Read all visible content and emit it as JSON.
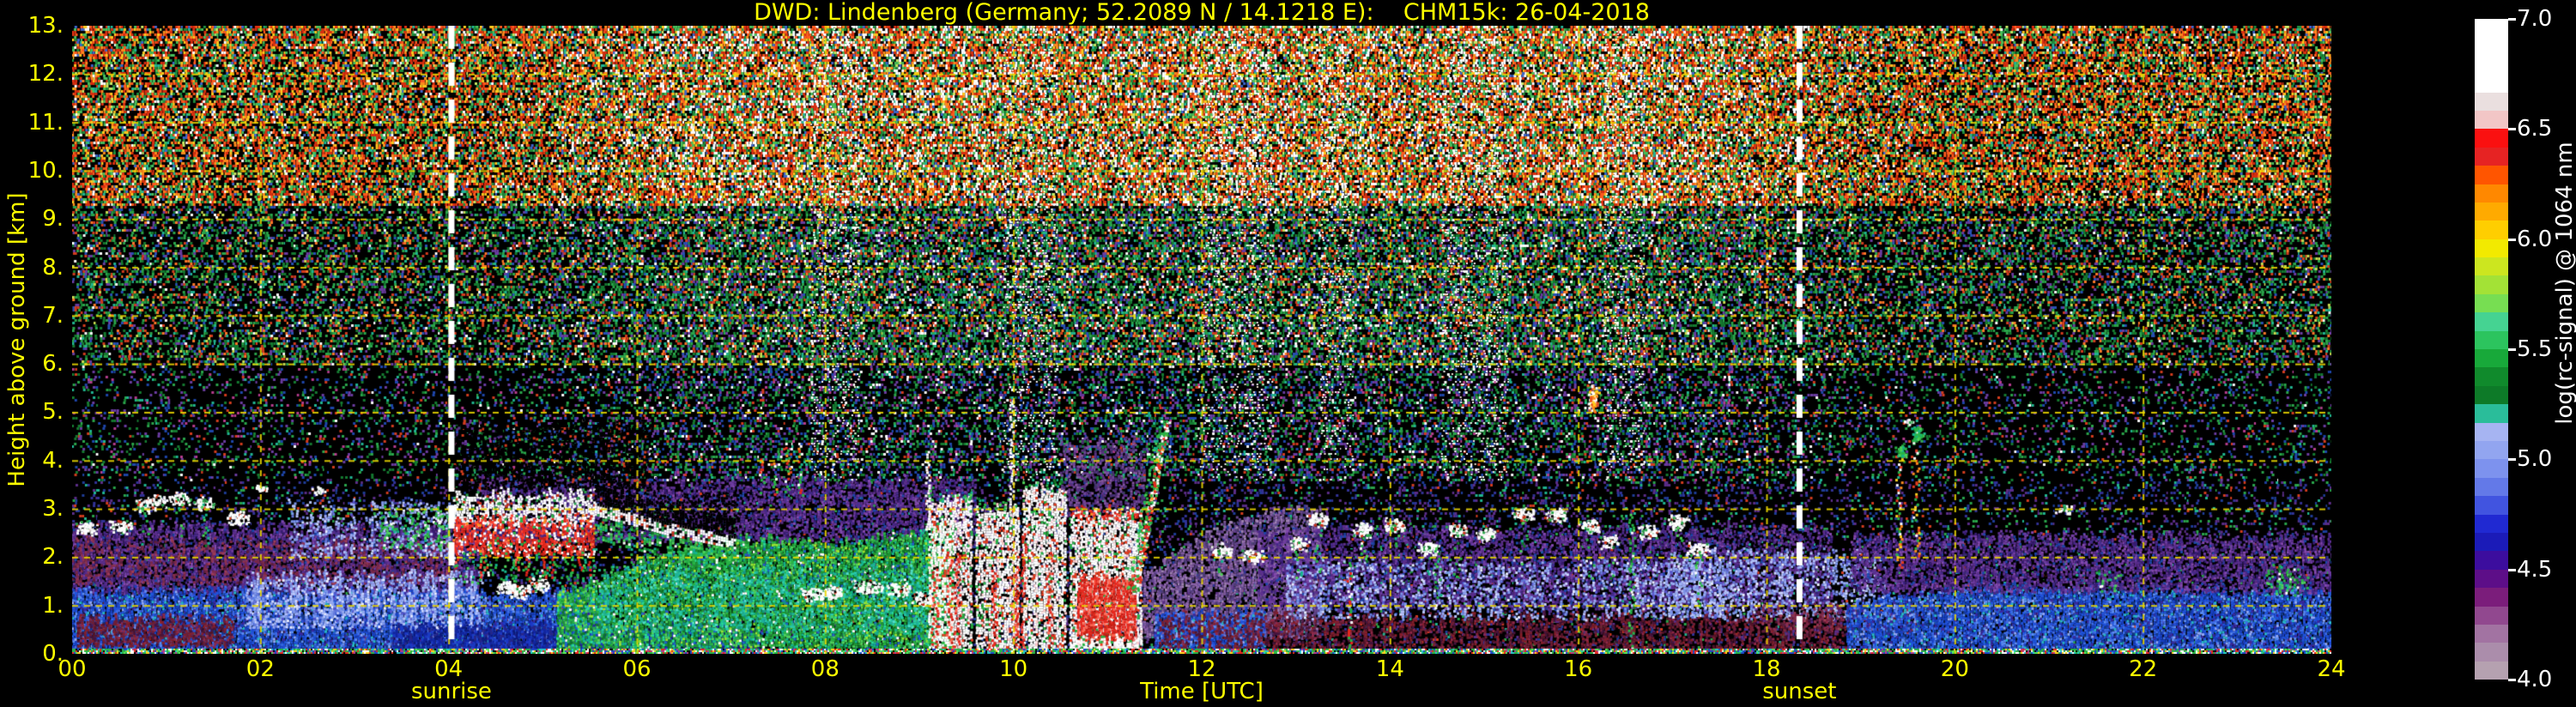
{
  "title": {
    "text": "DWD: Lindenberg (Germany; 52.2089 N / 14.1218 E):    CHM15k: 26-04-2018"
  },
  "axes": {
    "xlabel": "Time [UTC]",
    "ylabel": "Height above ground [km]",
    "x_ticks": [
      {
        "hour": 0,
        "label": "00"
      },
      {
        "hour": 2,
        "label": "02"
      },
      {
        "hour": 4,
        "label": "04"
      },
      {
        "hour": 6,
        "label": "06"
      },
      {
        "hour": 8,
        "label": "08"
      },
      {
        "hour": 10,
        "label": "10"
      },
      {
        "hour": 12,
        "label": "12"
      },
      {
        "hour": 14,
        "label": "14"
      },
      {
        "hour": 16,
        "label": "16"
      },
      {
        "hour": 18,
        "label": "18"
      },
      {
        "hour": 20,
        "label": "20"
      },
      {
        "hour": 22,
        "label": "22"
      },
      {
        "hour": 24,
        "label": "24"
      }
    ],
    "y_ticks": [
      {
        "km": 13,
        "label": "13."
      },
      {
        "km": 12,
        "label": "12."
      },
      {
        "km": 11,
        "label": "11."
      },
      {
        "km": 10,
        "label": "10."
      },
      {
        "km": 9,
        "label": "9."
      },
      {
        "km": 8,
        "label": "8."
      },
      {
        "km": 7,
        "label": "7."
      },
      {
        "km": 6,
        "label": "6."
      },
      {
        "km": 5,
        "label": "5."
      },
      {
        "km": 4,
        "label": "4."
      },
      {
        "km": 3,
        "label": "3."
      },
      {
        "km": 2,
        "label": "2."
      },
      {
        "km": 1,
        "label": "1."
      },
      {
        "km": 0,
        "label": "0."
      }
    ]
  },
  "annotations": {
    "sunrise": {
      "label": "sunrise",
      "hour": 4.03
    },
    "sunset": {
      "label": "sunset",
      "hour": 18.35
    }
  },
  "colorbar": {
    "label": "log(rc-signal) @ 1064 nm",
    "vmin": 4.0,
    "vmax": 7.0,
    "tick_labels": [
      "7.0",
      "6.5",
      "6.0",
      "5.5",
      "5.0",
      "4.5",
      "4.0"
    ],
    "colors": [
      "#ffffff",
      "#ffffff",
      "#ffffff",
      "#ffffff",
      "#eadfdf",
      "#f2c6c6",
      "#fa1010",
      "#e62323",
      "#ff5500",
      "#ff8800",
      "#ffaa00",
      "#ffce00",
      "#f2ea00",
      "#cce61f",
      "#a3e236",
      "#77de52",
      "#45d392",
      "#2cc45e",
      "#18a93a",
      "#108a2c",
      "#0d7a28",
      "#2abd9a",
      "#a6b4f2",
      "#92a5f0",
      "#7d92ee",
      "#6379e8",
      "#4154e0",
      "#2029d2",
      "#1b1bb8",
      "#3c0d9e",
      "#5d0e88",
      "#7b1d7b",
      "#91488f",
      "#a273a2",
      "#ab8dab",
      "#b5a1b0"
    ]
  },
  "style": {
    "text_color": "#ffff00",
    "colorbar_text_color": "#ffffff",
    "grid_color": "rgba(235,215,0,0.9)",
    "sun_line_color": "#ffffff",
    "background": "#000000"
  },
  "chart_data": {
    "type": "heatmap",
    "title": "DWD: Lindenberg (Germany; 52.2089 N / 14.1218 E):    CHM15k: 26-04-2018",
    "xlabel": "Time [UTC]",
    "ylabel": "Height above ground [km]",
    "zlabel": "log(rc-signal) @ 1064 nm",
    "x_range": [
      0,
      24
    ],
    "y_range": [
      0,
      13
    ],
    "z_range": [
      4.0,
      7.0
    ],
    "grid": {
      "x_step_hours": 2,
      "y_step_km": 1,
      "style": "yellow dashed"
    },
    "sun_lines_hours": [
      4.03,
      18.35
    ],
    "bright_columns": [
      [
        7.85,
        8.35
      ],
      [
        9.9,
        10.45
      ],
      [
        11.95,
        12.75
      ],
      [
        13.25,
        13.6
      ],
      [
        14.55,
        15.25
      ],
      [
        16.25,
        16.7
      ]
    ],
    "layers": [
      {
        "kind": "purple",
        "t0": 0,
        "t1": 4.3,
        "h0": 1.25,
        "h1": 2.65,
        "dens": 0.88
      },
      {
        "kind": "maroon",
        "t0": 0,
        "t1": 4.1,
        "h0": 1.45,
        "h1": 2.35,
        "dens": 0.6,
        "patch": true
      },
      {
        "kind": "blue",
        "t0": 0,
        "t1": 5.7,
        "h0": 0,
        "h1": 1.3,
        "dens": 0.97
      },
      {
        "kind": "maroon_low",
        "t0": 0.05,
        "t1": 1.7,
        "h0": 0.18,
        "h1": 0.72,
        "dens": 0.85
      },
      {
        "kind": "pale_blue",
        "t0": 1.85,
        "t1": 4.35,
        "h0": 0.55,
        "h1": 1.65,
        "dens": 0.8,
        "patch": true
      },
      {
        "kind": "pale_blue",
        "t0": 2.3,
        "t1": 4.1,
        "h0": 2.0,
        "h1": 3.1,
        "dens": 0.5,
        "patch": true
      },
      {
        "kind": "green_specks",
        "t0": 3.25,
        "t1": 4.05,
        "h0": 2.2,
        "h1": 3.0,
        "dens": 0.45,
        "patch": true
      },
      {
        "kind": "dark_blue",
        "t0": 3.4,
        "t1": 7.3,
        "h0": 0.08,
        "h1": 0.6,
        "dens": 0.95
      },
      {
        "kind": "purple",
        "t0": 4.3,
        "t1": 9.6,
        "h0": 2.35,
        "h1": 3.6,
        "dens": 0.75
      },
      {
        "kind": "green_layer",
        "t0": 5.15,
        "t1": 9.35,
        "h0": 0.12,
        "pts": [
          [
            5.15,
            1.25
          ],
          [
            6.1,
            2.0
          ],
          [
            7.0,
            2.4
          ],
          [
            8.3,
            2.3
          ],
          [
            9.35,
            2.7
          ]
        ],
        "dens": 0.97
      },
      {
        "kind": "teal",
        "t0": 5.6,
        "t1": 9.1,
        "h0": 0.5,
        "h1": 1.75,
        "dens": 0.45,
        "patch": true
      },
      {
        "kind": "shadow",
        "t0": 4.05,
        "t1": 6.15,
        "h0": 3.4,
        "h1": 4.8,
        "dens": 0.72
      },
      {
        "kind": "shadow",
        "t0": 5.6,
        "t1": 7.05,
        "h0": 2.55,
        "h1": 3.25,
        "dens": 0.5
      },
      {
        "kind": "purple_plume",
        "t0": 10.5,
        "t1": 11.4,
        "h0": 2.9,
        "h1": 4.4,
        "dens": 0.5
      },
      {
        "kind": "purple_cone",
        "t0": 11.3,
        "t1": 13.25,
        "h0": 0.35,
        "pts": [
          [
            11.3,
            1.6
          ],
          [
            11.9,
            2.3
          ],
          [
            12.5,
            2.9
          ],
          [
            13.25,
            3.0
          ]
        ],
        "dens": 0.8
      },
      {
        "kind": "blue",
        "t0": 11.5,
        "t1": 12.65,
        "h0": 0,
        "h1": 0.85,
        "dens": 0.95
      },
      {
        "kind": "purple",
        "t0": 12.6,
        "t1": 18.7,
        "h0": 0.95,
        "h1": 2.6,
        "dens": 0.7
      },
      {
        "kind": "maroon_low",
        "t0": 11.55,
        "t1": 18.85,
        "h0": 0.08,
        "h1": 0.8,
        "dens": 0.8,
        "patch": true
      },
      {
        "kind": "blue_patch",
        "t0": 12.9,
        "t1": 17.6,
        "h0": 0.75,
        "h1": 1.9,
        "dens": 0.5,
        "patch": true
      },
      {
        "kind": "pale_blue",
        "t0": 16.95,
        "t1": 19.25,
        "h0": 0.75,
        "h1": 2.1,
        "dens": 0.6,
        "patch": true
      },
      {
        "kind": "maroon",
        "t0": 17.9,
        "t1": 19.6,
        "h0": 0.45,
        "h1": 0.95,
        "dens": 0.6,
        "patch": true
      },
      {
        "kind": "blue",
        "t0": 18.85,
        "t1": 24,
        "h0": 0,
        "pts": [
          [
            18.85,
            1.0
          ],
          [
            19.5,
            1.25
          ],
          [
            20.5,
            1.4
          ],
          [
            22,
            1.35
          ],
          [
            24,
            1.3
          ]
        ],
        "dens": 0.97
      },
      {
        "kind": "purple",
        "t0": 18.9,
        "t1": 24,
        "h0": 1.3,
        "h1": 2.45,
        "dens": 0.8
      }
    ],
    "features": [
      {
        "kind": "cumulus_row",
        "t0": 0.1,
        "t1": 1.8,
        "hb": 2.5,
        "ht": 3.25,
        "n": 7,
        "virga": 0.7
      },
      {
        "kind": "white_dots",
        "t": 2.0,
        "h": 3.45
      },
      {
        "kind": "white_dots",
        "t": 2.6,
        "h": 3.4
      },
      {
        "kind": "cloud_red",
        "t0": 4.05,
        "t1": 5.55,
        "h0": 2.05,
        "h1": 3.35
      },
      {
        "kind": "cumulus_row",
        "t0": 4.5,
        "t1": 5.05,
        "hb": 1.15,
        "ht": 1.45,
        "n": 3,
        "virga": 0.3
      },
      {
        "kind": "strato",
        "pts": [
          [
            5.55,
            3.0
          ],
          [
            6.3,
            2.6
          ],
          [
            7.05,
            2.3
          ]
        ]
      },
      {
        "kind": "green_streaks",
        "t0": 7.25,
        "t1": 7.8,
        "h0": 3.3,
        "h1": 4.35
      },
      {
        "kind": "cumulus_row",
        "t0": 7.75,
        "t1": 9.15,
        "hb": 1.15,
        "ht": 1.6,
        "n": 6,
        "virga": 0.4
      },
      {
        "kind": "spike",
        "t": 9.08,
        "h0": 2.5,
        "h1": 4.2
      },
      {
        "kind": "precip",
        "t0": 9.1,
        "t1": 9.55,
        "ht": 3.2
      },
      {
        "kind": "precip",
        "t0": 9.6,
        "t1": 10.05,
        "ht": 3.0
      },
      {
        "kind": "spike",
        "t": 9.97,
        "h0": 2.9,
        "h1": 5.25
      },
      {
        "kind": "precip",
        "t0": 10.1,
        "t1": 10.55,
        "ht": 3.45
      },
      {
        "kind": "precip_major",
        "t0": 10.6,
        "t1": 11.35,
        "ht": 2.9
      },
      {
        "kind": "diag",
        "tA": 11.28,
        "hA": 1.3,
        "tB": 11.62,
        "hB": 4.85
      },
      {
        "kind": "cumulus_row",
        "t0": 12.05,
        "t1": 17.55,
        "hb": 2.0,
        "ht": 2.95,
        "n": 16,
        "virga": 0.6
      },
      {
        "kind": "red_spike",
        "t": 13.56,
        "h0": 0.05,
        "h1": 1.9
      },
      {
        "kind": "green_column",
        "t": 14.5,
        "h0": 0.9,
        "h1": 2.2
      },
      {
        "kind": "green_column",
        "t": 16.56,
        "h0": 0.05,
        "h1": 2.9
      },
      {
        "kind": "spot",
        "t": 16.15,
        "h0": 5.0,
        "h1": 5.65
      },
      {
        "kind": "evening_streaks",
        "t0": 19.35,
        "t1": 19.7,
        "h0": 1.8,
        "h1": 4.55
      },
      {
        "kind": "green_specks",
        "t0": 21.5,
        "t1": 21.75,
        "h0": 1.35,
        "h1": 1.7,
        "dens": 0.5
      },
      {
        "kind": "white_dots",
        "t": 21.15,
        "h": 3.0
      },
      {
        "kind": "green_specks",
        "t0": 23.3,
        "t1": 23.75,
        "h0": 1.25,
        "h1": 1.75,
        "dens": 0.6
      }
    ]
  }
}
